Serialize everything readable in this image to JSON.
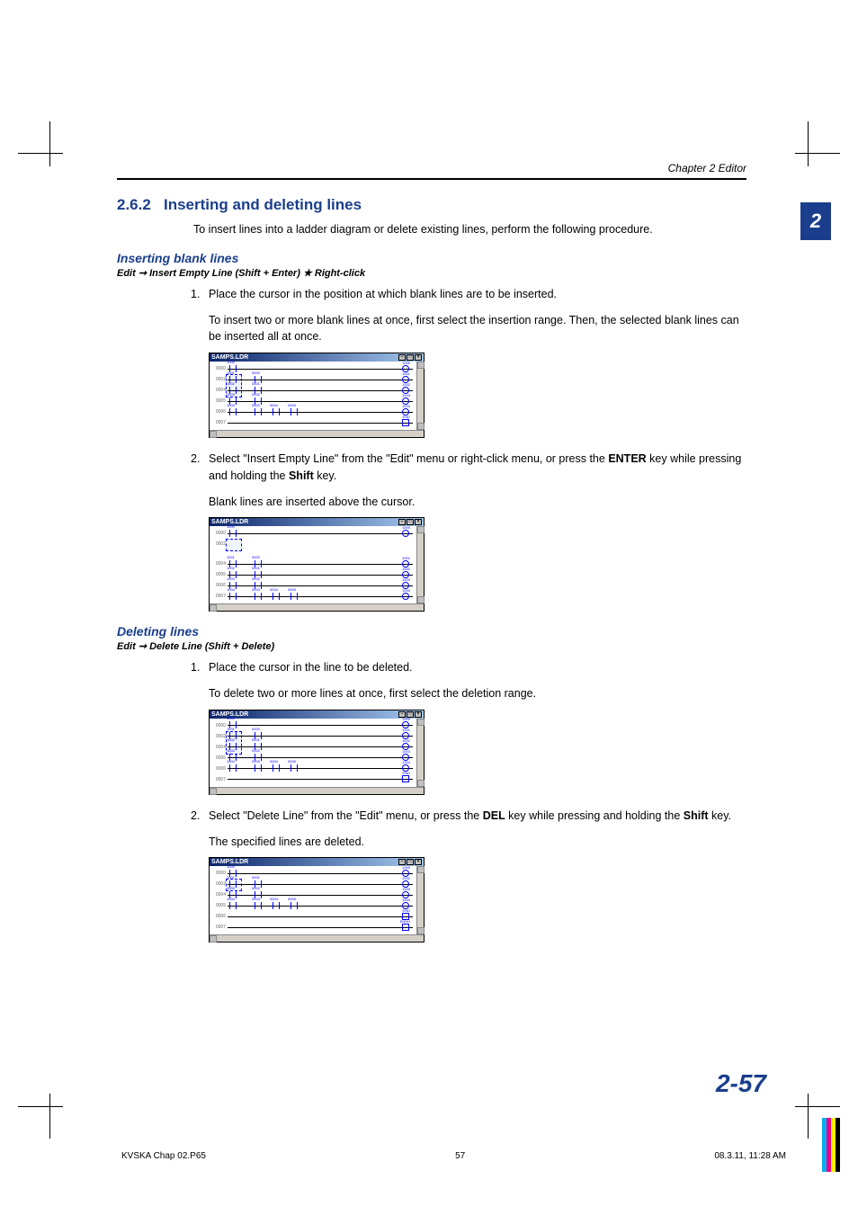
{
  "header": {
    "chapter": "Chapter 2  Editor"
  },
  "tab": "2",
  "section": {
    "number": "2.6.2",
    "title": "Inserting and deleting lines"
  },
  "intro": "To insert lines into a ladder diagram or delete existing lines, perform the following procedure.",
  "inserting": {
    "heading": "Inserting blank lines",
    "path_prefix": "Edit ➞ Insert Empty Line (Shift + Enter) ",
    "path_star": "★",
    "path_suffix": "  Right-click",
    "step1": {
      "num": "1.",
      "text": "Place the cursor in the position at which blank lines are to be inserted.",
      "note": "To insert two or more blank lines at once, first select the insertion range. Then, the selected blank lines can be inserted all at once."
    },
    "step2": {
      "num": "2.",
      "text_a": "Select \"Insert Empty Line\" from the \"Edit\" menu or right-click menu, or press the ",
      "key1": "ENTER",
      "text_b": " key while pressing and holding the ",
      "key2": "Shift",
      "text_c": " key.",
      "note": "Blank lines are inserted above the cursor."
    }
  },
  "deleting": {
    "heading": "Deleting lines",
    "path": "Edit ➞ Delete Line (Shift + Delete)",
    "step1": {
      "num": "1.",
      "text": "Place the cursor in the line to be deleted.",
      "note": "To delete two or more lines at once, first select the deletion range."
    },
    "step2": {
      "num": "2.",
      "text_a": "Select \"Delete Line\" from the \"Edit\" menu, or press the ",
      "key1": "DEL",
      "text_b": " key while pressing and holding the ",
      "key2": "Shift",
      "text_c": " key.",
      "note": "The specified lines are deleted."
    }
  },
  "window_title": "SAMPS.LDR",
  "page_number": "2-57",
  "footer": {
    "file": "KVSKA Chap 02.P65",
    "page": "57",
    "timestamp": "08.3.11, 11:28 AM"
  },
  "color_bars": [
    "#00aeef",
    "#ec008c",
    "#fff200",
    "#000000"
  ]
}
